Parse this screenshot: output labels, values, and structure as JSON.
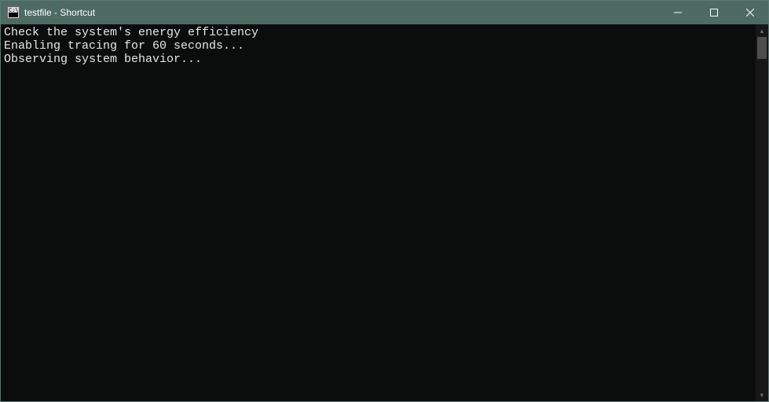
{
  "window": {
    "title": "testfile - Shortcut"
  },
  "console": {
    "lines": [
      "Check the system's energy efficiency",
      "Enabling tracing for 60 seconds...",
      "Observing system behavior..."
    ]
  }
}
